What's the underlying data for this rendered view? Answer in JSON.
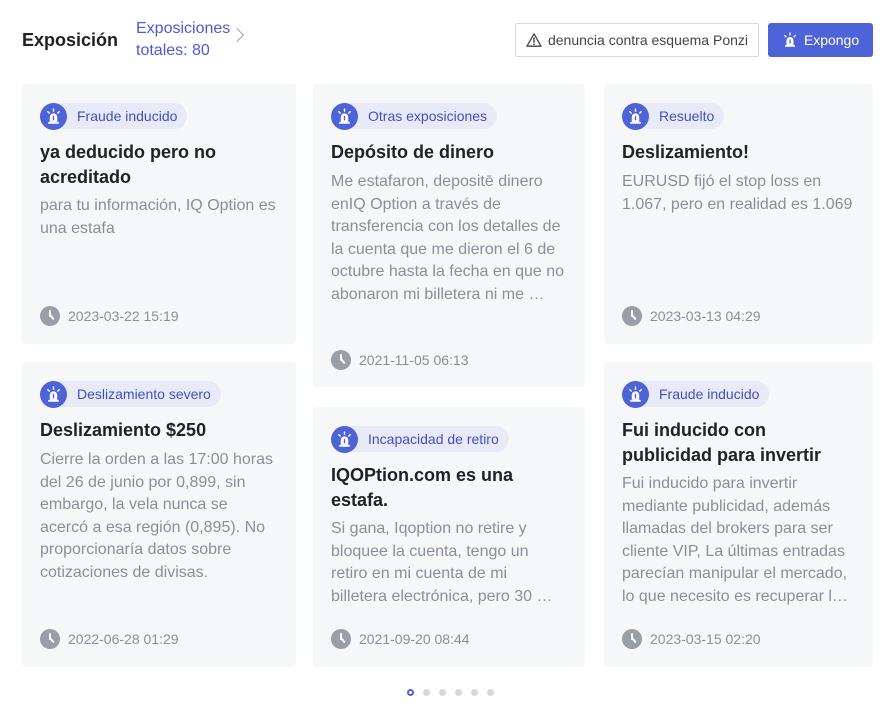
{
  "header": {
    "title": "Exposición",
    "total_line1": "Exposiciones",
    "total_line2": "totales: 80",
    "ponzi_button": "denuncia contra esquema Ponzi",
    "expose_button": "Expongo"
  },
  "colors": {
    "accent": "#4f63d8",
    "tag_bg": "#e8ebf7",
    "card_bg": "#f6f7f9",
    "muted_text": "#8a8f99"
  },
  "icons": {
    "tag": "alarm-siren-icon",
    "date": "clock-icon",
    "warning": "warning-triangle-icon",
    "chevron": "chevron-right-icon"
  },
  "cards": [
    {
      "tag": "Fraude inducido",
      "title": "ya deducido pero no acreditado",
      "body": "para tu información, IQ Option es una estafa",
      "date": "2023-03-22 15:19"
    },
    {
      "tag": "Deslizamiento severo",
      "title": "Deslizamiento $250",
      "body": "Cierre la orden a las 17:00 horas del 26 de junio por 0,899, sin embargo, la vela nunca se acercó a esa región (0,895). No proporcionaría datos sobre cotizaciones de divisas.",
      "date": "2022-06-28 01:29"
    },
    {
      "tag": "Otras exposiciones",
      "title": "Depósito de dinero",
      "body": "Me estafaron, depositē dinero enIQ Option a través de transferencia con los detalles de la cuenta que me dieron el 6 de octubre hasta la fecha en que no abonaron mi billetera ni me …",
      "date": "2021-11-05 06:13"
    },
    {
      "tag": "Incapacidad de retiro",
      "title": "IQOPtion.com es una estafa.",
      "body": "Si gana, Iqoption no retire y bloquee la cuenta, tengo un retiro en mi cuenta de mi billetera electrónica, pero 30 …",
      "date": "2021-09-20 08:44"
    },
    {
      "tag": "Resuelto",
      "title": "Deslizamiento!",
      "body": "EURUSD fijó el stop loss en 1.067, pero en realidad es 1.069",
      "date": "2023-03-13 04:29"
    },
    {
      "tag": "Fraude inducido",
      "title": "Fui inducido con publicidad para invertir",
      "body": "Fui inducido para invertir mediante publicidad, además llamadas del brokers para ser cliente VIP, La últimas entradas parecían manipular el mercado, lo que necesito es recuperar la …",
      "date": "2023-03-15 02:20"
    }
  ],
  "pagination": {
    "total_pages": 6,
    "current_page": 1
  }
}
